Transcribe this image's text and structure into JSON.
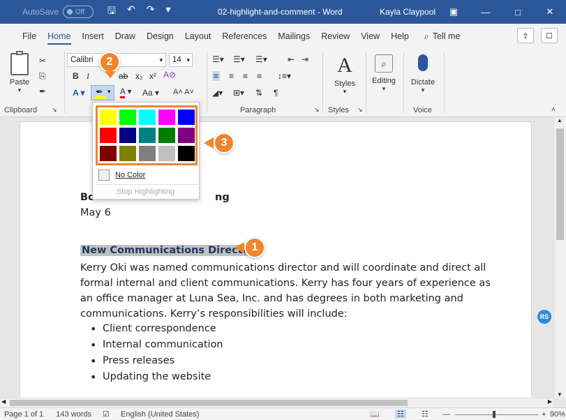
{
  "titlebar": {
    "autosave_label": "AutoSave",
    "autosave_state": "Off",
    "doc_title": "02-highlight-and-comment - Word",
    "user_name": "Kayla Claypool"
  },
  "tabs": [
    "File",
    "Home",
    "Insert",
    "Draw",
    "Design",
    "Layout",
    "References",
    "Mailings",
    "Review",
    "View",
    "Help"
  ],
  "tell_me": "Tell me",
  "ribbon": {
    "paste_label": "Paste",
    "font_name": "Calibri",
    "font_size": "14",
    "styles_label": "Styles",
    "editing_label": "Editing",
    "dictate_label": "Dictate",
    "aa_label": "Aa",
    "groups": {
      "clipboard": "Clipboard",
      "paragraph": "Paragraph",
      "styles": "Styles",
      "voice": "Voice"
    }
  },
  "highlight_menu": {
    "no_color": "No Color",
    "stop": "Stop Highlighting",
    "colors": [
      "#ffff00",
      "#00ff00",
      "#00ffff",
      "#ff00ff",
      "#0000ff",
      "#ff0000",
      "#000080",
      "#008080",
      "#008000",
      "#800080",
      "#800000",
      "#808000",
      "#808080",
      "#c0c0c0",
      "#000000"
    ]
  },
  "document": {
    "line1_start": "Bo",
    "line1_end": "ng",
    "date": "May 6",
    "heading": "New Communications Director",
    "paragraph_lines": [
      "Kerry Oki was named communications director and will coordinate and direct all",
      "formal internal and client communications. Kerry has four years of experience as",
      "an office manager at Luna Sea, Inc. and has degrees in both marketing and",
      "communications. Kerry’s responsibilities will include:"
    ],
    "bullets": [
      "Client correspondence",
      "Internal communication",
      "Press releases",
      "Updating the website"
    ],
    "comment_avatar": "RS"
  },
  "callouts": [
    "1",
    "2",
    "3"
  ],
  "status": {
    "page": "Page 1 of 1",
    "words": "143 words",
    "language": "English (United States)",
    "zoom": "90%"
  },
  "colors": {
    "accent": "#2b579a",
    "callout": "#f0852d",
    "heading": "#1f3864",
    "selection": "#c0c0c0"
  }
}
